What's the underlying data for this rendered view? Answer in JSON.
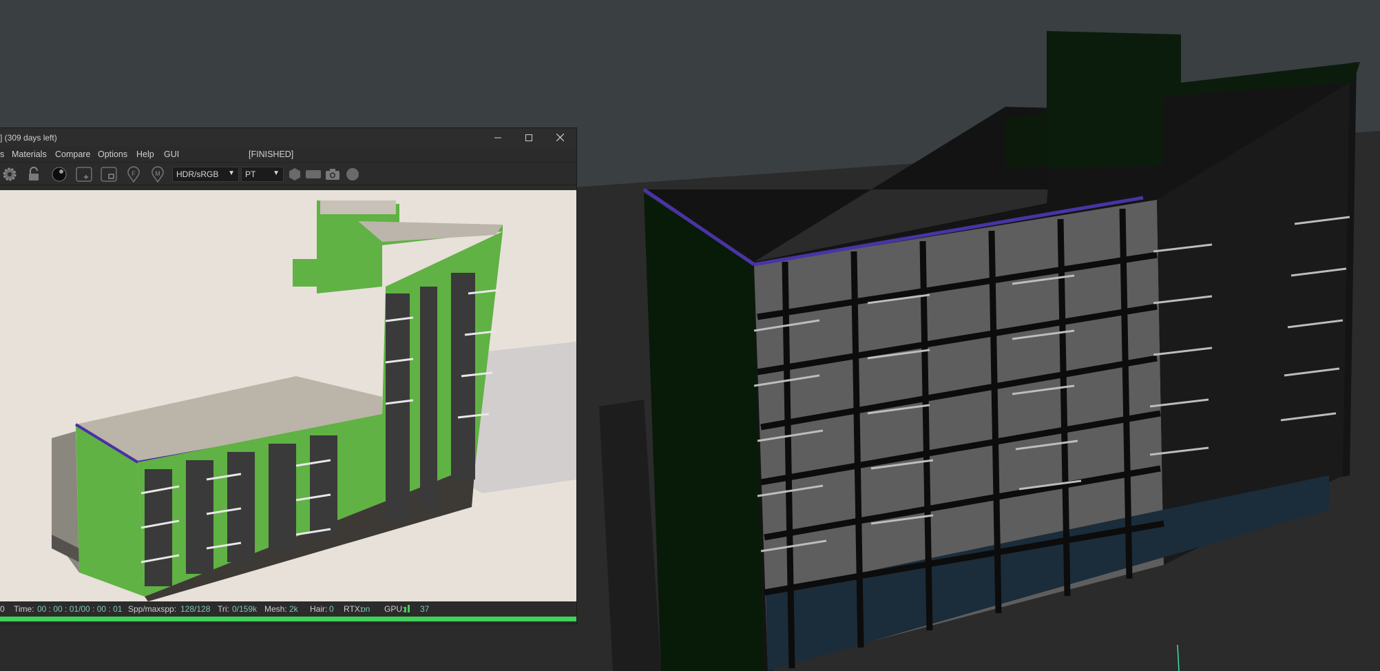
{
  "window": {
    "title": "] (309 days left)",
    "controls": [
      "minimize",
      "maximize",
      "close"
    ]
  },
  "menu": {
    "items": [
      "s",
      "Materials",
      "Compare",
      "Options",
      "Help",
      "GUI"
    ],
    "status": "[FINISHED]"
  },
  "toolbar": {
    "icons": [
      "gear-icon",
      "lock-icon",
      "sphere-icon",
      "add-icon",
      "frame-icon",
      "f-pin-icon",
      "m-pin-icon",
      "hexagon-icon",
      "rectangle-icon",
      "camera-icon",
      "circle-icon"
    ],
    "colorspace": {
      "value": "HDR/sRGB"
    },
    "mode": {
      "value": "PT"
    }
  },
  "statusbar": {
    "lead": "0",
    "time_label": "Time:",
    "time_value": "00 : 00 : 01/00 : 00 : 01",
    "spp_label": "Spp/maxspp:",
    "spp_value": "128/128",
    "tri_label": "Tri:",
    "tri_value": "0/159k",
    "mesh_label": "Mesh:",
    "mesh_value": "2k",
    "hair_label": "Hair:",
    "hair_value": "0",
    "rtx_label": "RTX:",
    "rtx_value": "on",
    "gpu_label": "GPU:",
    "gpu_value": "37"
  },
  "progress": {
    "fraction": 1.0
  },
  "colors": {
    "accent_green": "#3fd35a",
    "value_teal": "#7ec9b0",
    "building_green": "#5cae3d",
    "parapet_purple": "#5a2fb0"
  }
}
